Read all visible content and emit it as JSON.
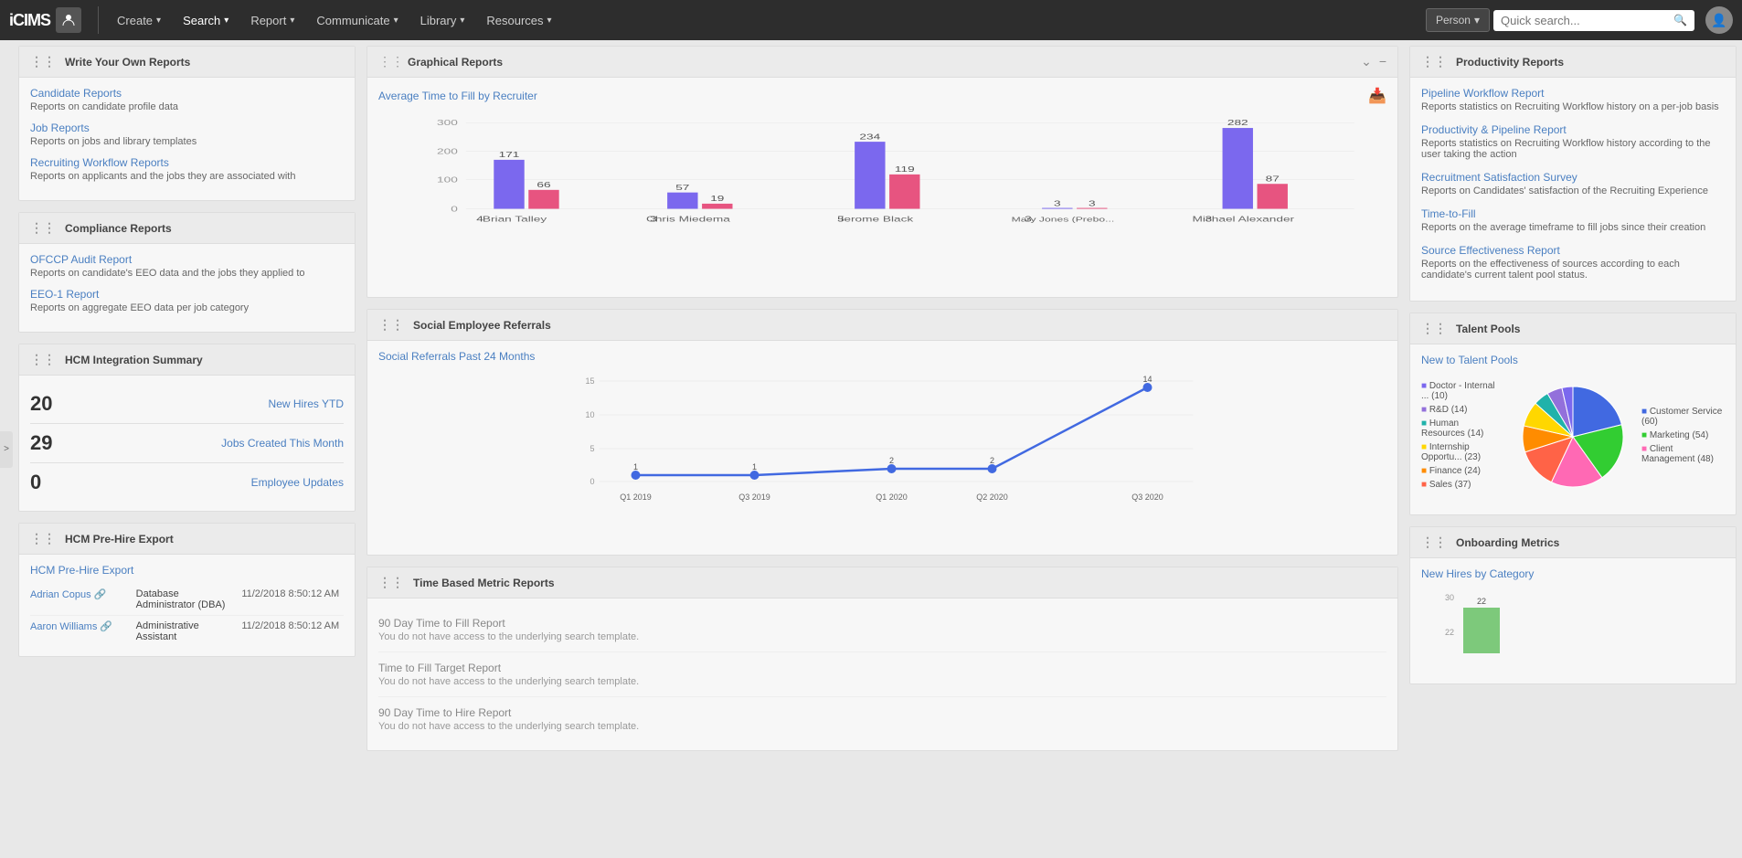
{
  "nav": {
    "logo": "iCIMS",
    "items": [
      {
        "label": "Create",
        "chevron": "▾"
      },
      {
        "label": "Search",
        "chevron": "▾"
      },
      {
        "label": "Report",
        "chevron": "▾"
      },
      {
        "label": "Communicate",
        "chevron": "▾"
      },
      {
        "label": "Library",
        "chevron": "▾"
      },
      {
        "label": "Resources",
        "chevron": "▾"
      }
    ],
    "person_btn": "Person",
    "search_placeholder": "Quick search..."
  },
  "write_reports": {
    "title": "Write Your Own Reports",
    "items": [
      {
        "link": "Candidate Reports",
        "desc": "Reports on candidate profile data"
      },
      {
        "link": "Job Reports",
        "desc": "Reports on jobs and library templates"
      },
      {
        "link": "Recruiting Workflow Reports",
        "desc": "Reports on applicants and the jobs they are associated with"
      }
    ]
  },
  "compliance": {
    "title": "Compliance Reports",
    "items": [
      {
        "link": "OFCCP Audit Report",
        "desc": "Reports on candidate's EEO data and the jobs they applied to"
      },
      {
        "link": "EEO-1 Report",
        "desc": "Reports on aggregate EEO data per job category"
      }
    ]
  },
  "hcm_integration": {
    "title": "HCM Integration Summary",
    "stats": [
      {
        "number": "20",
        "label": "New Hires YTD"
      },
      {
        "number": "29",
        "label": "Jobs Created This Month"
      },
      {
        "number": "0",
        "label": "Employee Updates"
      }
    ]
  },
  "hcm_prehire": {
    "title": "HCM Pre-Hire Export",
    "top_link": "HCM Pre-Hire Export",
    "rows": [
      {
        "name": "Adrian Copus",
        "role": "Database Administrator (DBA)",
        "date": "11/2/2018 8:50:12 AM"
      },
      {
        "name": "Aaron Williams",
        "role": "Administrative Assistant",
        "date": "11/2/2018 8:50:12 AM"
      }
    ]
  },
  "graphical": {
    "title": "Graphical Reports",
    "chart_title": "Average Time to Fill by Recruiter",
    "bars": [
      {
        "name": "Brian Talley",
        "purple": 171,
        "pink": 66,
        "label_p": "171",
        "label_pk": "66",
        "left_num": "4"
      },
      {
        "name": "Chris Miedema",
        "purple": 57,
        "pink": 19,
        "label_p": "57",
        "label_pk": "19",
        "left_num": "3"
      },
      {
        "name": "Jerome Black",
        "purple": 234,
        "pink": 119,
        "label_p": "234",
        "label_pk": "119",
        "left_num": "5"
      },
      {
        "name": "Mary Jones (Prebo...",
        "purple": 3,
        "pink": 3,
        "label_p": "3",
        "label_pk": "3",
        "left_num": "3"
      },
      {
        "name": "Michael Alexander",
        "purple": 282,
        "pink": 87,
        "label_p": "282",
        "label_pk": "87",
        "left_num": "3"
      }
    ],
    "y_labels": [
      "300",
      "200",
      "100",
      "0"
    ]
  },
  "social": {
    "title": "Social Employee Referrals",
    "chart_title": "Social Referrals Past 24 Months",
    "points": [
      {
        "x": "Q1 2019",
        "y": 1
      },
      {
        "x": "Q3 2019",
        "y": 1
      },
      {
        "x": "Q1 2020",
        "y": 2
      },
      {
        "x": "Q2 2020",
        "y": 2
      },
      {
        "x": "Q3 2020",
        "y": 14
      }
    ],
    "y_labels": [
      "15",
      "10",
      "5",
      "0"
    ]
  },
  "time_based": {
    "title": "Time Based Metric Reports",
    "items": [
      {
        "title": "90 Day Time to Fill Report",
        "desc": "You do not have access to the underlying search template."
      },
      {
        "title": "Time to Fill Target Report",
        "desc": "You do not have access to the underlying search template."
      },
      {
        "title": "90 Day Time to Hire Report",
        "desc": "You do not have access to the underlying search template."
      }
    ]
  },
  "productivity": {
    "title": "Productivity Reports",
    "items": [
      {
        "link": "Pipeline Workflow Report",
        "desc": "Reports statistics on Recruiting Workflow history on a per-job basis"
      },
      {
        "link": "Productivity & Pipeline Report",
        "desc": "Reports statistics on Recruiting Workflow history according to the user taking the action"
      },
      {
        "link": "Recruitment Satisfaction Survey",
        "desc": "Reports on Candidates' satisfaction of the Recruiting Experience"
      },
      {
        "link": "Time-to-Fill",
        "desc": "Reports on the average timeframe to fill jobs since their creation"
      },
      {
        "link": "Source Effectiveness Report",
        "desc": "Reports on the effectiveness of sources according to each candidate's current talent pool status."
      }
    ]
  },
  "talent_pools": {
    "title": "Talent Pools",
    "link": "New to Talent Pools",
    "legend": [
      {
        "label": "Doctor - Internal ... (10)",
        "color": "#7b68ee"
      },
      {
        "label": "R&D (14)",
        "color": "#9370db"
      },
      {
        "label": "Human Resources (14)",
        "color": "#20b2aa"
      },
      {
        "label": "Internship Opportu... (23)",
        "color": "#ffd700"
      },
      {
        "label": "Finance (24)",
        "color": "#ff8c00"
      },
      {
        "label": "Sales (37)",
        "color": "#ff6347"
      },
      {
        "label": "Customer Service (60)",
        "color": "#4169e1"
      },
      {
        "label": "Marketing (54)",
        "color": "#32cd32"
      },
      {
        "label": "Client Management (48)",
        "color": "#ff69b4"
      }
    ],
    "pie_slices": [
      {
        "label": "Customer Service",
        "value": 60,
        "color": "#4169e1"
      },
      {
        "label": "Marketing",
        "value": 54,
        "color": "#32cd32"
      },
      {
        "label": "Client Management",
        "value": 48,
        "color": "#ff69b4"
      },
      {
        "label": "Sales",
        "value": 37,
        "color": "#ff6347"
      },
      {
        "label": "Finance",
        "value": 24,
        "color": "#ff8c00"
      },
      {
        "label": "Internship",
        "value": 23,
        "color": "#ffd700"
      },
      {
        "label": "Human Resources",
        "value": 14,
        "color": "#20b2aa"
      },
      {
        "label": "R&D",
        "value": 14,
        "color": "#9370db"
      },
      {
        "label": "Doctor Internal",
        "value": 10,
        "color": "#7b68ee"
      }
    ]
  },
  "onboarding": {
    "title": "Onboarding Metrics",
    "link": "New Hires by Category",
    "y_labels": [
      "30",
      "",
      "22"
    ],
    "bar_value": 22
  }
}
